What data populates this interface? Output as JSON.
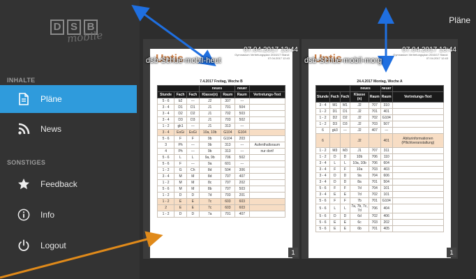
{
  "header": {
    "title": "Pläne"
  },
  "sidebar": {
    "logo_letters": [
      "D",
      "S",
      "B"
    ],
    "logo_sub": "mobile",
    "section_content": "INHALTE",
    "section_other": "SONSTIGES",
    "items": [
      {
        "label": "Pläne",
        "icon": "document-icon",
        "active": true
      },
      {
        "label": "News",
        "icon": "rss-icon",
        "active": false
      },
      {
        "label": "Feedback",
        "icon": "star-icon",
        "active": false
      },
      {
        "label": "Info",
        "icon": "info-icon",
        "active": false
      },
      {
        "label": "Logout",
        "icon": "power-icon",
        "active": false
      }
    ]
  },
  "colors": {
    "accent": "#2f9bdc",
    "sidebar": "#333333",
    "arrow_blue": "#1f6fe0",
    "arrow_orange": "#e08a1a"
  },
  "cards": [
    {
      "title": "dsb-Schue-mobil-heut",
      "timestamp": "07.04.2017 13:44",
      "page": "1",
      "brand": "Untis",
      "school": "Gymnasium Vertretungsplan 2016/17 Stand: 07.04.2017 12:43",
      "day": "7.4.2017 Freitag, Woche B",
      "headers": [
        "Stunde",
        "Fach",
        "Fach",
        "Klasse(n)",
        "Raum",
        "Raum",
        "Vertretungs-Text"
      ],
      "group_old": "neues",
      "group_new": "neuer",
      "rows": [
        [
          "5 - 6",
          "b2",
          "---",
          "J2",
          "307",
          "---",
          ""
        ],
        [
          "3 - 4",
          "D1",
          "D1",
          "J1",
          "701",
          "504",
          ""
        ],
        [
          "3 - 4",
          "D2",
          "D2",
          "J1",
          "702",
          "503",
          ""
        ],
        [
          "3 - 4",
          "D3",
          "D3",
          "J1",
          "703",
          "502",
          ""
        ],
        [
          "1 - 2",
          "gk1",
          "---",
          "J1",
          "313",
          "---",
          ""
        ],
        [
          "3 - 4",
          "EsGi",
          "EsGi",
          "10a, 10b",
          "G104",
          "G104",
          ""
        ],
        [
          "5 - 6",
          "F",
          "F",
          "9b",
          "G104",
          "203",
          ""
        ],
        [
          "3",
          "Ph",
          "---",
          "9b",
          "313",
          "---",
          "Aufenthaltsraum"
        ],
        [
          "4",
          "Ph",
          "---",
          "9b",
          "313",
          "---",
          "nur dort!"
        ],
        [
          "5 - 6",
          "L",
          "L",
          "9a, 9b",
          "706",
          "502",
          ""
        ],
        [
          "5 - 6",
          "F",
          "---",
          "9a",
          "601",
          "---",
          ""
        ],
        [
          "1 - 2",
          "G",
          "Ch",
          "8d",
          "504",
          "306",
          ""
        ],
        [
          "3 - 4",
          "M",
          "M",
          "8d",
          "707",
          "407",
          ""
        ],
        [
          "1 - 2",
          "M",
          "M",
          "8c",
          "707",
          "202",
          ""
        ],
        [
          "5 - 6",
          "M",
          "M",
          "8b",
          "707",
          "503",
          ""
        ],
        [
          "1 - 2",
          "D",
          "D",
          "7d",
          "703",
          "201",
          ""
        ],
        [
          "1 - 2",
          "E",
          "E",
          "7c",
          "603",
          "603",
          ""
        ],
        [
          "2",
          "E",
          "E",
          "7c",
          "603",
          "603",
          ""
        ],
        [
          "1 - 2",
          "D",
          "D",
          "7a",
          "701",
          "407",
          ""
        ]
      ]
    },
    {
      "title": "dsb-Schue-mobil-morg",
      "timestamp": "07.04.2017 13:44",
      "page": "1",
      "brand": "Untis",
      "school": "Gymnasium Vertretungsplan 2016/17 Stand: 07.04.2017 12:43",
      "day": "24.4.2017 Montag, Woche A",
      "headers": [
        "Stunde",
        "Fach",
        "Fach",
        "Klasse (n)",
        "Raum",
        "Raum",
        "Vertretungs-Text"
      ],
      "group_old": "neues",
      "group_new": "neuer",
      "rows": [
        [
          "3 - 4",
          "M1",
          "M1",
          "J2",
          "707",
          "310",
          ""
        ],
        [
          "1 - 2",
          "D1",
          "D1",
          "J2",
          "701",
          "401",
          ""
        ],
        [
          "1 - 2",
          "D2",
          "D2",
          "J2",
          "702",
          "G104",
          ""
        ],
        [
          "1 - 2",
          "D3",
          "D3",
          "J2",
          "703",
          "507",
          ""
        ],
        [
          "6",
          "gk3",
          "---",
          "J2",
          "407",
          "---",
          ""
        ],
        [
          "6",
          "",
          "",
          "J2",
          "",
          "401",
          "Abiturinformationen (Pflichtveranstaltung)"
        ],
        [
          "1 - 2",
          "M3",
          "M3",
          "J1",
          "707",
          "311",
          ""
        ],
        [
          "1 - 2",
          "D",
          "D",
          "10b",
          "706",
          "110",
          ""
        ],
        [
          "3 - 4",
          "L",
          "L",
          "10a, 10b",
          "706",
          "604",
          ""
        ],
        [
          "3 - 4",
          "F",
          "F",
          "10a",
          "703",
          "403",
          ""
        ],
        [
          "3 - 4",
          "D",
          "D",
          "9a",
          "704",
          "606",
          ""
        ],
        [
          "3 - 4",
          "D",
          "D",
          "8a",
          "701",
          "504",
          ""
        ],
        [
          "5 - 6",
          "F",
          "F",
          "7d",
          "704",
          "101",
          ""
        ],
        [
          "3 - 4",
          "E",
          "E",
          "7d",
          "702",
          "101",
          ""
        ],
        [
          "5 - 6",
          "F",
          "F",
          "7b",
          "701",
          "G104",
          ""
        ],
        [
          "5 - 6",
          "L",
          "L",
          "7a, 7b, 7c, 7d",
          "706",
          "404",
          ""
        ],
        [
          "5 - 6",
          "D",
          "D",
          "6d",
          "702",
          "406",
          ""
        ],
        [
          "5 - 6",
          "E",
          "E",
          "6c",
          "703",
          "202",
          ""
        ],
        [
          "5 - 6",
          "E",
          "E",
          "6b",
          "701",
          "405",
          ""
        ]
      ]
    }
  ]
}
